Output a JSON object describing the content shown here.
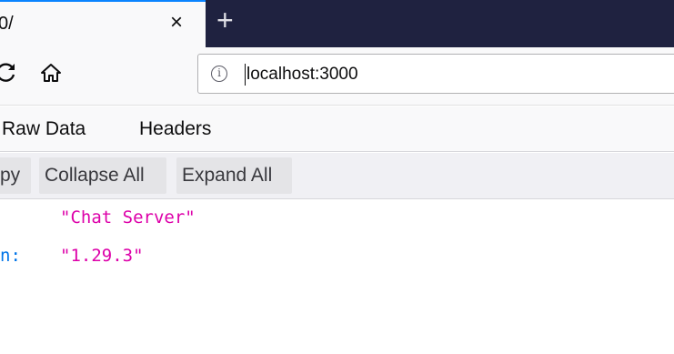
{
  "browser": {
    "tab": {
      "title": "0/",
      "close_glyph": "×"
    },
    "new_tab_glyph": "+",
    "nav": {
      "reload_icon": "reload-icon",
      "home_icon": "home-icon"
    },
    "urlbar": {
      "info_glyph": "i",
      "url": "localhost:3000"
    }
  },
  "viewer": {
    "tabs": [
      {
        "label": "Raw Data"
      },
      {
        "label": "Headers"
      }
    ],
    "toolbar": {
      "copy_label": "py",
      "collapse_label": "Collapse All",
      "expand_label": "Expand All"
    },
    "rows": [
      {
        "key": "",
        "value": "\"Chat Server\""
      },
      {
        "key": "n:",
        "value": "\"1.29.3\""
      }
    ]
  },
  "colors": {
    "tabstrip": "#1f2240",
    "accent": "#0a84ff",
    "json_key": "#0074e8",
    "json_string": "#dd00a9"
  }
}
